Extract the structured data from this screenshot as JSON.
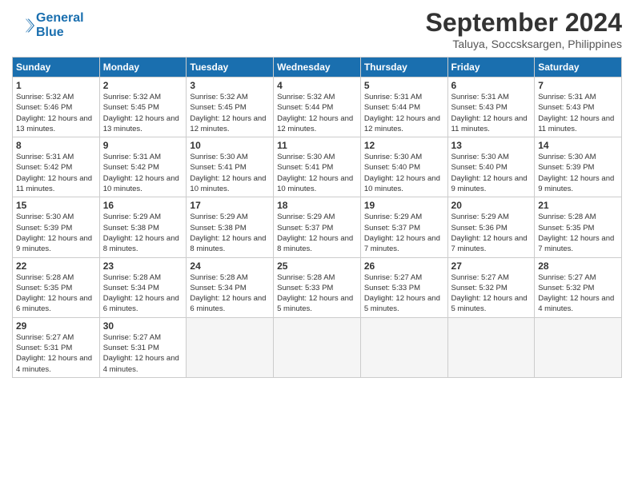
{
  "header": {
    "logo_line1": "General",
    "logo_line2": "Blue",
    "month_title": "September 2024",
    "location": "Taluya, Soccsksargen, Philippines"
  },
  "days_of_week": [
    "Sunday",
    "Monday",
    "Tuesday",
    "Wednesday",
    "Thursday",
    "Friday",
    "Saturday"
  ],
  "weeks": [
    [
      {
        "num": "1",
        "sunrise": "5:32 AM",
        "sunset": "5:46 PM",
        "daylight": "12 hours and 13 minutes."
      },
      {
        "num": "2",
        "sunrise": "5:32 AM",
        "sunset": "5:45 PM",
        "daylight": "12 hours and 13 minutes."
      },
      {
        "num": "3",
        "sunrise": "5:32 AM",
        "sunset": "5:45 PM",
        "daylight": "12 hours and 12 minutes."
      },
      {
        "num": "4",
        "sunrise": "5:32 AM",
        "sunset": "5:44 PM",
        "daylight": "12 hours and 12 minutes."
      },
      {
        "num": "5",
        "sunrise": "5:31 AM",
        "sunset": "5:44 PM",
        "daylight": "12 hours and 12 minutes."
      },
      {
        "num": "6",
        "sunrise": "5:31 AM",
        "sunset": "5:43 PM",
        "daylight": "12 hours and 11 minutes."
      },
      {
        "num": "7",
        "sunrise": "5:31 AM",
        "sunset": "5:43 PM",
        "daylight": "12 hours and 11 minutes."
      }
    ],
    [
      {
        "num": "8",
        "sunrise": "5:31 AM",
        "sunset": "5:42 PM",
        "daylight": "12 hours and 11 minutes."
      },
      {
        "num": "9",
        "sunrise": "5:31 AM",
        "sunset": "5:42 PM",
        "daylight": "12 hours and 10 minutes."
      },
      {
        "num": "10",
        "sunrise": "5:30 AM",
        "sunset": "5:41 PM",
        "daylight": "12 hours and 10 minutes."
      },
      {
        "num": "11",
        "sunrise": "5:30 AM",
        "sunset": "5:41 PM",
        "daylight": "12 hours and 10 minutes."
      },
      {
        "num": "12",
        "sunrise": "5:30 AM",
        "sunset": "5:40 PM",
        "daylight": "12 hours and 10 minutes."
      },
      {
        "num": "13",
        "sunrise": "5:30 AM",
        "sunset": "5:40 PM",
        "daylight": "12 hours and 9 minutes."
      },
      {
        "num": "14",
        "sunrise": "5:30 AM",
        "sunset": "5:39 PM",
        "daylight": "12 hours and 9 minutes."
      }
    ],
    [
      {
        "num": "15",
        "sunrise": "5:30 AM",
        "sunset": "5:39 PM",
        "daylight": "12 hours and 9 minutes."
      },
      {
        "num": "16",
        "sunrise": "5:29 AM",
        "sunset": "5:38 PM",
        "daylight": "12 hours and 8 minutes."
      },
      {
        "num": "17",
        "sunrise": "5:29 AM",
        "sunset": "5:38 PM",
        "daylight": "12 hours and 8 minutes."
      },
      {
        "num": "18",
        "sunrise": "5:29 AM",
        "sunset": "5:37 PM",
        "daylight": "12 hours and 8 minutes."
      },
      {
        "num": "19",
        "sunrise": "5:29 AM",
        "sunset": "5:37 PM",
        "daylight": "12 hours and 7 minutes."
      },
      {
        "num": "20",
        "sunrise": "5:29 AM",
        "sunset": "5:36 PM",
        "daylight": "12 hours and 7 minutes."
      },
      {
        "num": "21",
        "sunrise": "5:28 AM",
        "sunset": "5:35 PM",
        "daylight": "12 hours and 7 minutes."
      }
    ],
    [
      {
        "num": "22",
        "sunrise": "5:28 AM",
        "sunset": "5:35 PM",
        "daylight": "12 hours and 6 minutes."
      },
      {
        "num": "23",
        "sunrise": "5:28 AM",
        "sunset": "5:34 PM",
        "daylight": "12 hours and 6 minutes."
      },
      {
        "num": "24",
        "sunrise": "5:28 AM",
        "sunset": "5:34 PM",
        "daylight": "12 hours and 6 minutes."
      },
      {
        "num": "25",
        "sunrise": "5:28 AM",
        "sunset": "5:33 PM",
        "daylight": "12 hours and 5 minutes."
      },
      {
        "num": "26",
        "sunrise": "5:27 AM",
        "sunset": "5:33 PM",
        "daylight": "12 hours and 5 minutes."
      },
      {
        "num": "27",
        "sunrise": "5:27 AM",
        "sunset": "5:32 PM",
        "daylight": "12 hours and 5 minutes."
      },
      {
        "num": "28",
        "sunrise": "5:27 AM",
        "sunset": "5:32 PM",
        "daylight": "12 hours and 4 minutes."
      }
    ],
    [
      {
        "num": "29",
        "sunrise": "5:27 AM",
        "sunset": "5:31 PM",
        "daylight": "12 hours and 4 minutes."
      },
      {
        "num": "30",
        "sunrise": "5:27 AM",
        "sunset": "5:31 PM",
        "daylight": "12 hours and 4 minutes."
      },
      null,
      null,
      null,
      null,
      null
    ]
  ]
}
